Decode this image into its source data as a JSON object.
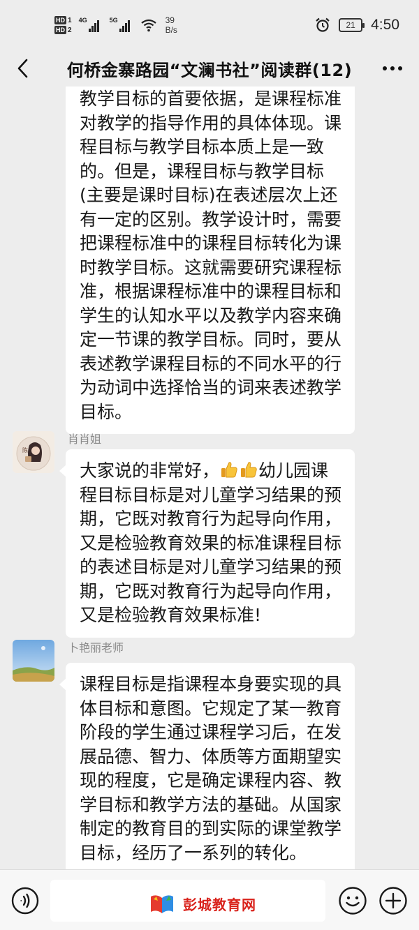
{
  "status_bar": {
    "hd1": "HD",
    "hd1_num": "1",
    "hd2": "HD",
    "hd2_num": "2",
    "sig1_label": "4G",
    "sig2_label": "5G",
    "speed_value": "39",
    "speed_unit": "B/s",
    "battery": "21",
    "time": "4:50"
  },
  "header": {
    "title": "何桥金寨路园“文澜书社”阅读群(12)"
  },
  "messages": [
    {
      "sender": "",
      "text": "教学目标的首要依据，是课程标准对教学的指导作用的具体体现。课程目标与教学目标本质上是一致的。但是，课程目标与教学目标(主要是课时目标)在表述层次上还有一定的区别。教学设计时，需要把课程标准中的课程目标转化为课时教学目标。这就需要研究课程标准，根据课程标准中的课程目标和学生的认知水平以及教学内容来确定一节课的教学目标。同时，要从表述教学课程目标的不同水平的行为动词中选择恰当的词来表述教学目标。"
    },
    {
      "sender": "肖肖姐",
      "avatar_text": "陈",
      "text_before": "大家说的非常好，",
      "emoji": "thumbs-up",
      "text_after": "幼儿园课程目标目标是对儿童学习结果的预期，它既对教育行为起导向作用，又是检验教育效果的标准课程目标的表述目标是对儿童学习结果的预期，它既对教育行为起导向作用，又是检验教育效果标准!"
    },
    {
      "sender": "卜艳丽老师",
      "text": "课程目标是指课程本身要实现的具体目标和意图。它规定了某一教育阶段的学生通过课程学习后，在发展品德、智力、体质等方面期望实现的程度，它是确定课程内容、教学目标和教学方法的基础。从国家制定的教育目的到实际的课堂教学目标，经历了一系列的转化。"
    }
  ],
  "input_bar": {
    "placeholder": ""
  },
  "watermark": {
    "text": "彭城教育网"
  },
  "colors": {
    "background": "#ededed",
    "bubble": "#ffffff",
    "watermark_red": "#d9231c"
  }
}
